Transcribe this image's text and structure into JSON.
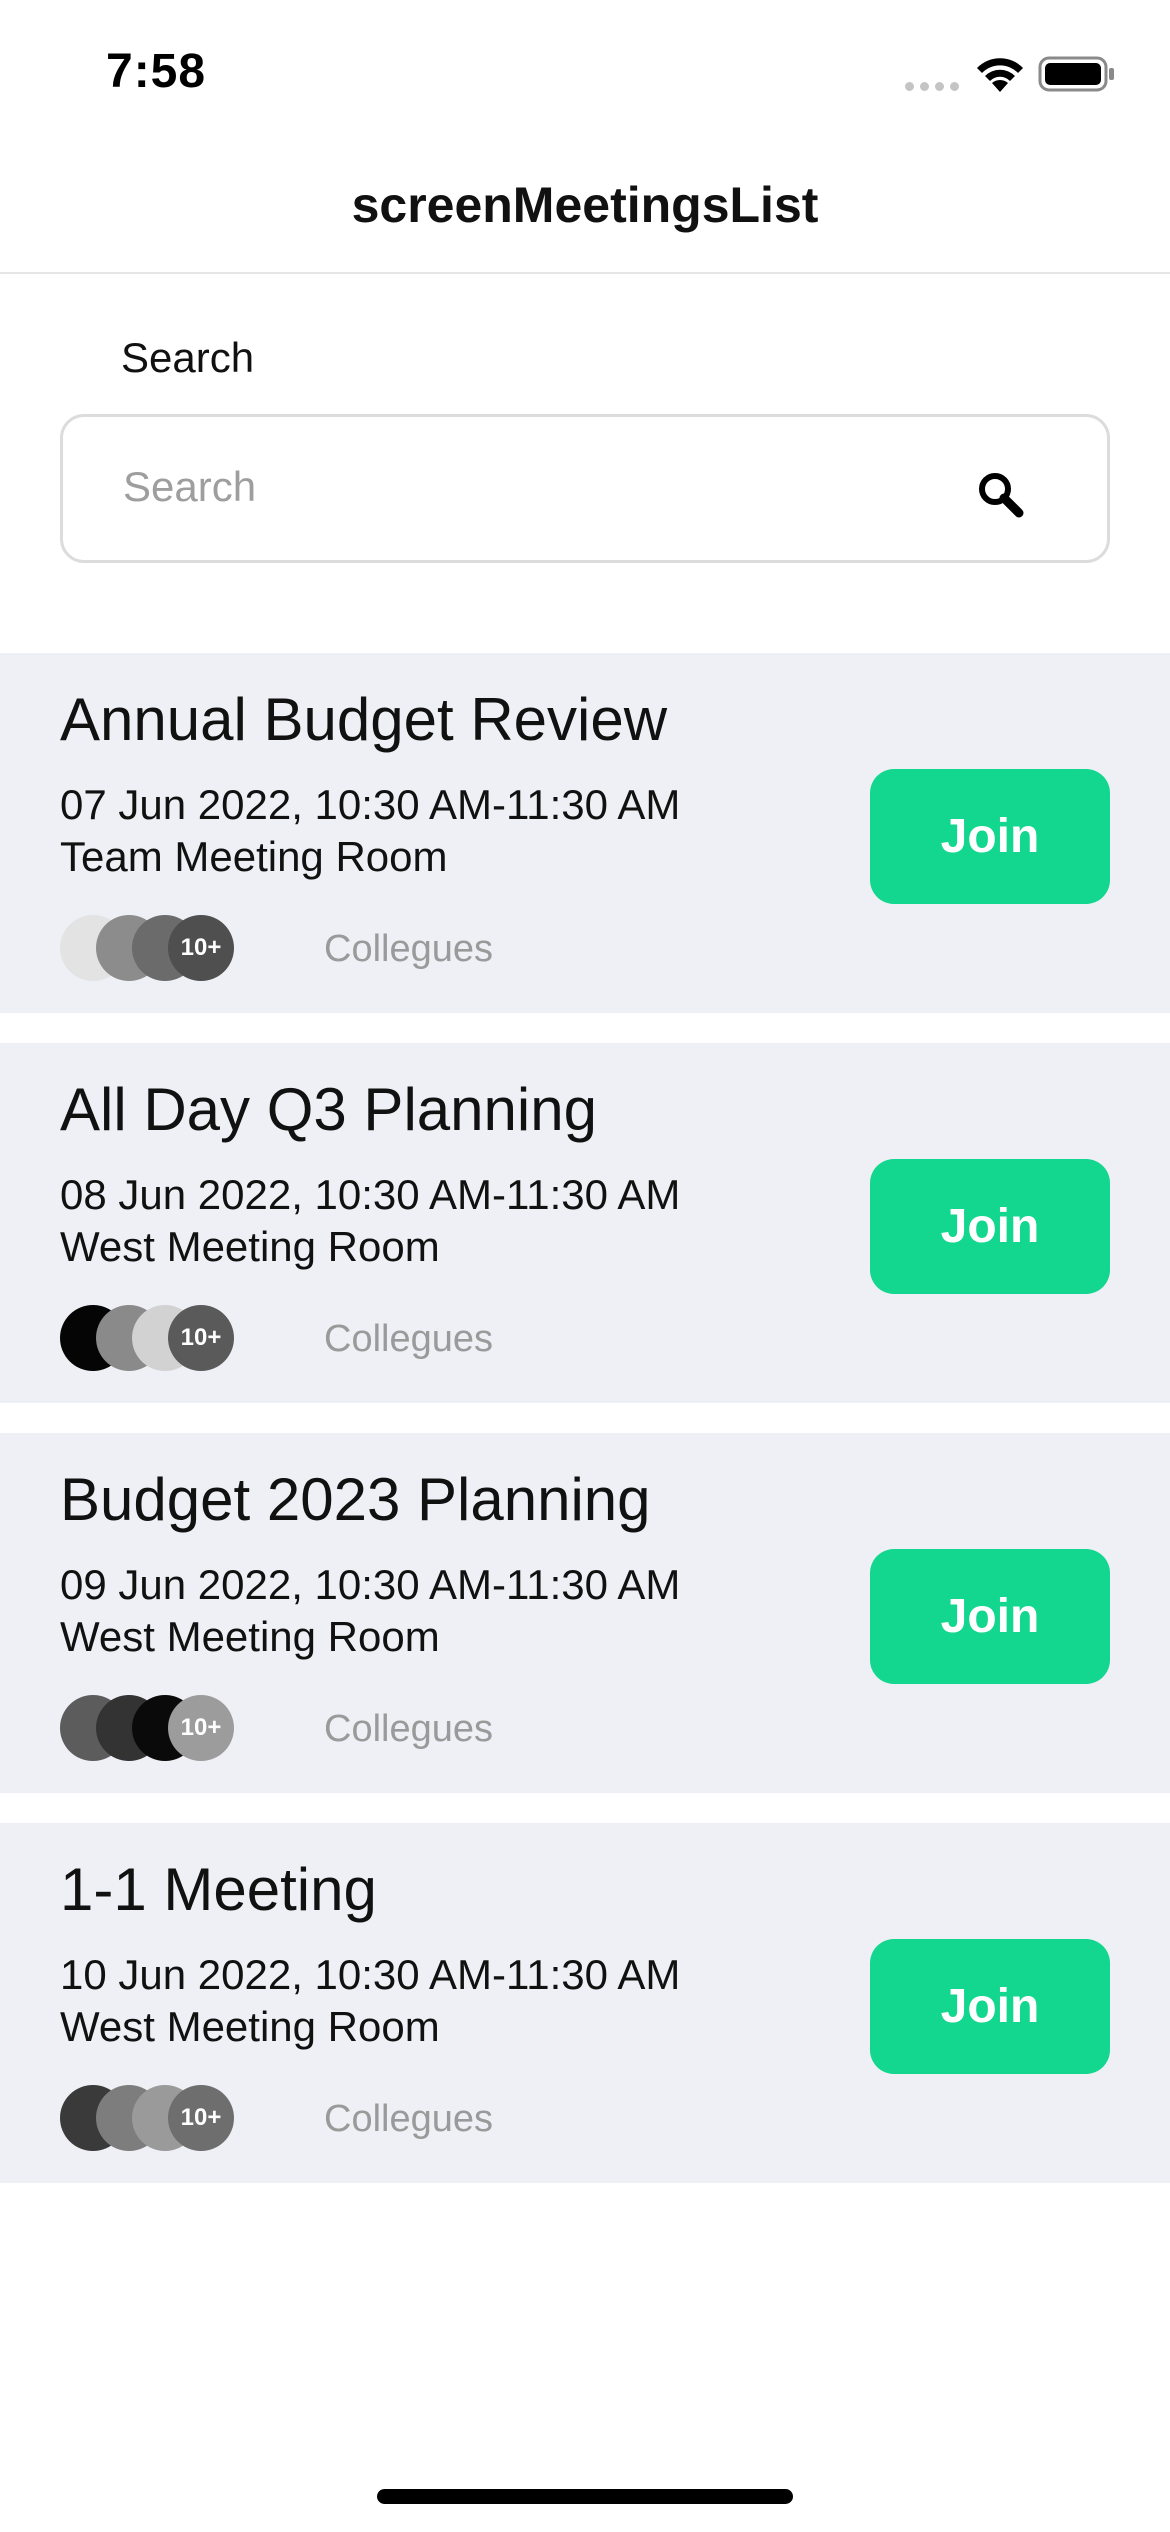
{
  "status_bar": {
    "time": "7:58",
    "icons": [
      "signal-dots-icon",
      "wifi-icon",
      "battery-icon"
    ]
  },
  "header": {
    "title": "screenMeetingsList"
  },
  "search": {
    "label": "Search",
    "placeholder": "Search",
    "value": "",
    "icon": "search-icon"
  },
  "colors": {
    "join_button": "#13d68f",
    "card_background": "#eff0f5",
    "muted_text": "#9a9a9a"
  },
  "meetings": [
    {
      "title": "Annual Budget Review",
      "datetime": "07 Jun 2022, 10:30 AM-11:30 AM",
      "room": "Team Meeting Room",
      "avatar_colors": [
        "#e3e3e3",
        "#8c8c8c",
        "#6b6b6b"
      ],
      "count_badge": "10+",
      "count_badge_color": "#4f4f4f",
      "colleagues_label": "Collegues",
      "join_label": "Join"
    },
    {
      "title": "All Day Q3 Planning",
      "datetime": "08 Jun 2022, 10:30 AM-11:30 AM",
      "room": "West Meeting Room",
      "avatar_colors": [
        "#050505",
        "#8a8a8a",
        "#d2d2d2"
      ],
      "count_badge": "10+",
      "count_badge_color": "#5a5a5a",
      "colleagues_label": "Collegues",
      "join_label": "Join"
    },
    {
      "title": "Budget 2023 Planning",
      "datetime": "09 Jun 2022, 10:30 AM-11:30 AM",
      "room": "West Meeting Room",
      "avatar_colors": [
        "#5c5c5c",
        "#333333",
        "#0a0a0a"
      ],
      "count_badge": "10+",
      "count_badge_color": "#9c9c9c",
      "colleagues_label": "Collegues",
      "join_label": "Join"
    },
    {
      "title": "1-1 Meeting",
      "datetime": "10 Jun 2022, 10:30 AM-11:30 AM",
      "room": "West Meeting Room",
      "avatar_colors": [
        "#3a3a3a",
        "#7d7d7d",
        "#9a9a9a"
      ],
      "count_badge": "10+",
      "count_badge_color": "#6e6e6e",
      "colleagues_label": "Collegues",
      "join_label": "Join"
    }
  ]
}
